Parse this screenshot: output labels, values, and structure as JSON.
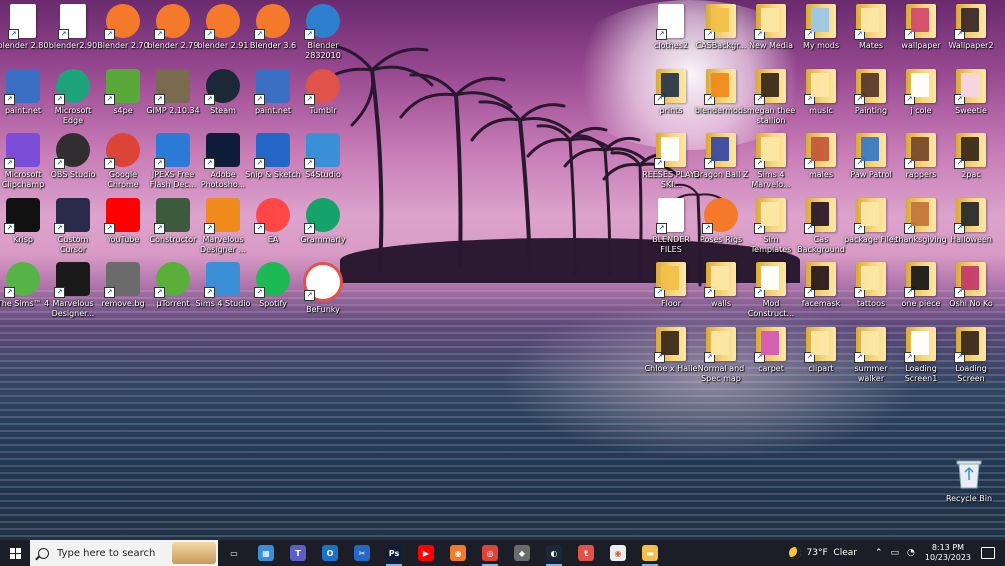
{
  "desktop": {
    "left_icons": [
      {
        "label": "blender 2.80",
        "icon": "file-icon",
        "color": "#ffffff"
      },
      {
        "label": "blender2.90",
        "icon": "file-icon",
        "color": "#ffffff"
      },
      {
        "label": "Blender 2.70",
        "icon": "blender-icon",
        "color": "#f5792a"
      },
      {
        "label": "blender 2.79",
        "icon": "blender-icon",
        "color": "#f5792a"
      },
      {
        "label": "blender 2.91",
        "icon": "blender-icon",
        "color": "#f5792a"
      },
      {
        "label": "Blender 3.6",
        "icon": "blender-icon",
        "color": "#f5792a"
      },
      {
        "label": "Blender 2832010",
        "icon": "blender-icon",
        "color": "#2f7fd1"
      },
      {
        "label": "paint.net",
        "icon": "paintnet-icon",
        "color": "#3a6fc4"
      },
      {
        "label": "Microsoft Edge",
        "icon": "edge-icon",
        "color": "#1fa37a"
      },
      {
        "label": "s4pe",
        "icon": "s4pe-icon",
        "color": "#5aa83a"
      },
      {
        "label": "GIMP 2.10.34",
        "icon": "gimp-icon",
        "color": "#7a6a50"
      },
      {
        "label": "Steam",
        "icon": "steam-icon",
        "color": "#1b2838"
      },
      {
        "label": "paint.net",
        "icon": "paintnet-icon",
        "color": "#3a6fc4"
      },
      {
        "label": "Tumblr",
        "icon": "tumblr-icon",
        "color": "#e0524a"
      },
      {
        "label": "Microsoft Clipchamp",
        "icon": "clipchamp-icon",
        "color": "#7c4dd8"
      },
      {
        "label": "OBS Studio",
        "icon": "obs-icon",
        "color": "#302e31"
      },
      {
        "label": "Google Chrome",
        "icon": "chrome-icon",
        "color": "#db4437"
      },
      {
        "label": "JPEXS Free Flash Dec...",
        "icon": "jpexs-icon",
        "color": "#2b7bd6"
      },
      {
        "label": "Adobe Photosho...",
        "icon": "photoshop-icon",
        "color": "#0f1d3a"
      },
      {
        "label": "Snip & Sketch",
        "icon": "snip-icon",
        "color": "#2467c7"
      },
      {
        "label": "S4Studio",
        "icon": "s4studio-icon",
        "color": "#3a8fd6"
      },
      {
        "label": "Krisp",
        "icon": "krisp-icon",
        "color": "#111111"
      },
      {
        "label": "Custom Cursor",
        "icon": "cursor-icon",
        "color": "#2a2a4a"
      },
      {
        "label": "YouTube",
        "icon": "youtube-icon",
        "color": "#ff0000"
      },
      {
        "label": "Constructor",
        "icon": "constructor-icon",
        "color": "#3d5a3d"
      },
      {
        "label": "Marvelous Designer ...",
        "icon": "marvelous-icon",
        "color": "#f08a1c"
      },
      {
        "label": "EA",
        "icon": "ea-icon",
        "color": "#ff4747"
      },
      {
        "label": "Grammarly",
        "icon": "grammarly-icon",
        "color": "#15a36b"
      },
      {
        "label": "The Sims™ 4",
        "icon": "sims-icon",
        "color": "#56b447"
      },
      {
        "label": "Marvelous Designer...",
        "icon": "marvelous-m-icon",
        "color": "#1a1a1a"
      },
      {
        "label": "remove.bg",
        "icon": "removebg-icon",
        "color": "#6b6b6b"
      },
      {
        "label": "µTorrent",
        "icon": "utorrent-icon",
        "color": "#5aaf3a"
      },
      {
        "label": "Sims 4 Studio",
        "icon": "s4studio-icon",
        "color": "#3a8fd6"
      },
      {
        "label": "Spotify",
        "icon": "spotify-icon",
        "color": "#1db954"
      },
      {
        "label": "BeFunky",
        "icon": "befunky-icon",
        "color": "#ffffff"
      }
    ],
    "right_icons": [
      {
        "label": "clothes2",
        "icon": "file-icon",
        "color": "#ffffff"
      },
      {
        "label": "CASBackgr...",
        "icon": "folder-icon",
        "color": "#f2c04a"
      },
      {
        "label": "New Media",
        "icon": "folder-icon",
        "color": "#fbe7a6"
      },
      {
        "label": "My mods",
        "icon": "folder-icon",
        "color": "#9bc7e6"
      },
      {
        "label": "Mates",
        "icon": "folder-icon",
        "color": "#fbe7a6"
      },
      {
        "label": "wallpaper",
        "icon": "folder-icon",
        "color": "#d44a6a"
      },
      {
        "label": "Wallpaper2",
        "icon": "folder-icon",
        "color": "#3a2a2a"
      },
      {
        "label": "prints",
        "icon": "folder-icon",
        "color": "#2a3a4a"
      },
      {
        "label": "blendermods",
        "icon": "folder-icon",
        "color": "#f08a1c"
      },
      {
        "label": "megan thee stallion",
        "icon": "folder-icon",
        "color": "#3a2a1a"
      },
      {
        "label": "music",
        "icon": "folder-icon",
        "color": "#fbe7a6"
      },
      {
        "label": "Painting",
        "icon": "folder-icon",
        "color": "#5a3a2a"
      },
      {
        "label": "j cole",
        "icon": "folder-icon",
        "color": "#ffffff"
      },
      {
        "label": "Sweetie",
        "icon": "folder-icon",
        "color": "#f5d5e5"
      },
      {
        "label": "REESES PLAYS SKI...",
        "icon": "folder-icon",
        "color": "#ffffff"
      },
      {
        "label": "Dragon Ball Z",
        "icon": "folder-icon",
        "color": "#3a4aa0"
      },
      {
        "label": "Sims 4 Marvelo...",
        "icon": "folder-icon",
        "color": "#fbe7a6"
      },
      {
        "label": "males",
        "icon": "folder-icon",
        "color": "#c45a3a"
      },
      {
        "label": "Paw Patrol",
        "icon": "folder-icon",
        "color": "#3a7ac4"
      },
      {
        "label": "rappers",
        "icon": "folder-icon",
        "color": "#7a4a2a"
      },
      {
        "label": "2pac",
        "icon": "folder-icon",
        "color": "#3a2a1a"
      },
      {
        "label": "BLENDER FILES",
        "icon": "file-icon",
        "color": "#ffffff"
      },
      {
        "label": "Poses Rigs",
        "icon": "blender-icon",
        "color": "#f5792a"
      },
      {
        "label": "Sim Templates",
        "icon": "folder-icon",
        "color": "#fbe7a6"
      },
      {
        "label": "Cas Background",
        "icon": "folder-icon",
        "color": "#2a1a2a"
      },
      {
        "label": "package Files",
        "icon": "folder-icon",
        "color": "#fbe7a6"
      },
      {
        "label": "thanksgiving",
        "icon": "folder-icon",
        "color": "#c4763a"
      },
      {
        "label": "Halloween",
        "icon": "folder-icon",
        "color": "#2a2a2a"
      },
      {
        "label": "Floor",
        "icon": "folder-icon",
        "color": "#f2c04a"
      },
      {
        "label": "walls",
        "icon": "folder-icon",
        "color": "#fbe7a6"
      },
      {
        "label": "Mod Construct...",
        "icon": "folder-icon",
        "color": "#ffffff"
      },
      {
        "label": "facemask",
        "icon": "folder-icon",
        "color": "#2a1a1a"
      },
      {
        "label": "tattoos",
        "icon": "folder-icon",
        "color": "#fbe7a6"
      },
      {
        "label": "one piece",
        "icon": "folder-icon",
        "color": "#1a1a1a"
      },
      {
        "label": "Oshi No Ko",
        "icon": "folder-icon",
        "color": "#c43a6a"
      },
      {
        "label": "Chloe x Halle",
        "icon": "folder-icon",
        "color": "#3a2a1a"
      },
      {
        "label": "Normal and Spec map",
        "icon": "folder-icon",
        "color": "#fbe7a6"
      },
      {
        "label": "carpet",
        "icon": "folder-icon",
        "color": "#d45ab4"
      },
      {
        "label": "clipart",
        "icon": "folder-icon",
        "color": "#fbe7a6"
      },
      {
        "label": "summer walker",
        "icon": "folder-icon",
        "color": "#fbe7a6"
      },
      {
        "label": "Loading Screen1",
        "icon": "folder-icon",
        "color": "#ffffff"
      },
      {
        "label": "Loading Screen",
        "icon": "folder-icon",
        "color": "#3a2a1a"
      }
    ],
    "recycle_bin": {
      "label": "Recycle Bin",
      "icon": "recycle-bin-icon"
    }
  },
  "taskbar": {
    "search_placeholder": "Type here to search",
    "apps": [
      {
        "name": "task-view",
        "icon": "task-view-icon",
        "color": "#1b1e26",
        "glyph": "▭"
      },
      {
        "name": "microsoft-store",
        "icon": "store-icon",
        "color": "#3a8fd6",
        "glyph": "▦"
      },
      {
        "name": "teams",
        "icon": "teams-icon",
        "color": "#5b5fc7",
        "glyph": "T"
      },
      {
        "name": "outlook",
        "icon": "outlook-icon",
        "color": "#1a73c8",
        "glyph": "O"
      },
      {
        "name": "snip-sketch",
        "icon": "snip-icon",
        "color": "#2467c7",
        "glyph": "✂"
      },
      {
        "name": "photoshop",
        "icon": "photoshop-icon",
        "color": "#0f1d3a",
        "glyph": "Ps"
      },
      {
        "name": "youtube",
        "icon": "youtube-icon",
        "color": "#ff0000",
        "glyph": "▶"
      },
      {
        "name": "blender",
        "icon": "blender-icon",
        "color": "#f5792a",
        "glyph": "◉"
      },
      {
        "name": "chrome",
        "icon": "chrome-icon",
        "color": "#db4437",
        "glyph": "◎"
      },
      {
        "name": "remove-bg",
        "icon": "removebg-icon",
        "color": "#6b6b6b",
        "glyph": "◆"
      },
      {
        "name": "steam",
        "icon": "steam-icon",
        "color": "#1b2838",
        "glyph": "◐"
      },
      {
        "name": "tumblr",
        "icon": "tumblr-icon",
        "color": "#e0524a",
        "glyph": "t"
      },
      {
        "name": "befunky",
        "icon": "befunky-icon",
        "color": "#eeeeee",
        "glyph": "◉"
      },
      {
        "name": "file-explorer",
        "icon": "folder-icon",
        "color": "#f2c04a",
        "glyph": "▬"
      }
    ],
    "weather": {
      "temp": "73°F",
      "condition": "Clear"
    },
    "clock": {
      "time": "8:13 PM",
      "date": "10/23/2023"
    }
  }
}
